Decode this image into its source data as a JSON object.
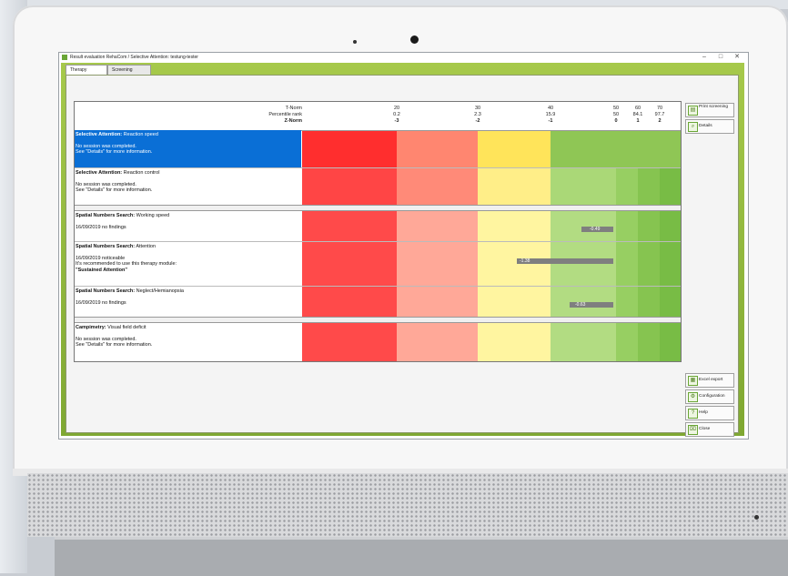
{
  "window": {
    "title": "Result evaluation RehaCom / Selective Attention: testung-tester",
    "controls": [
      "–",
      "□",
      "✕"
    ]
  },
  "tabs": [
    "Therapy",
    "Screening"
  ],
  "header": {
    "labels": [
      "T-Norm",
      "Percentile rank",
      "Z-Norm"
    ],
    "columns": [
      {
        "t": "20",
        "p": "0.2",
        "z": "-3"
      },
      {
        "t": "30",
        "p": "2.3",
        "z": "-2"
      },
      {
        "t": "40",
        "p": "15.9",
        "z": "-1"
      },
      {
        "t": "50",
        "p": "50",
        "z": "0"
      },
      {
        "t": "60",
        "p": "84.1",
        "z": "1"
      },
      {
        "t": "70",
        "p": "97.7",
        "z": "2"
      }
    ]
  },
  "rows": [
    {
      "title": "Selective Attention:",
      "subtitle": "Reaction speed",
      "line1": "No session was completed.",
      "line2": "See \"Details\" for more information.",
      "line3": "",
      "selected": true
    },
    {
      "title": "Selective Attention:",
      "subtitle": "Reaction control",
      "line1": "No session was completed.",
      "line2": "See \"Details\" for more information.",
      "line3": "",
      "selected": false
    },
    {
      "title": "Spatial Numbers Search:",
      "subtitle": "Working speed",
      "line1": "16/09/2019 no findings",
      "line2": "",
      "line3": "",
      "selected": false,
      "bar_value": "-0.49"
    },
    {
      "title": "Spatial Numbers Search:",
      "subtitle": "Attention",
      "line1": "16/09/2019 noticeable",
      "line2": "It's recommended to use this therapy module:",
      "line3": "\"Sustained Attention\"",
      "selected": false,
      "bar_value": "-1.38"
    },
    {
      "title": "Spatial Numbers Search:",
      "subtitle": "Neglect/Hemianopsia",
      "line1": "16/09/2019 no findings",
      "line2": "",
      "line3": "",
      "selected": false,
      "bar_value": "-0.63"
    },
    {
      "title": "Campimetry:",
      "subtitle": "Visual field deficit",
      "line1": "No session was completed.",
      "line2": "See \"Details\" for more information.",
      "line3": "",
      "selected": false
    }
  ],
  "side_buttons": {
    "print": "Print screening",
    "details": "Details",
    "excel": "Excel export",
    "config": "Configuration",
    "help": "Help",
    "close": "Close"
  },
  "colors": {
    "selected_row": "#0a6fd6",
    "frame_green": "#8db33a"
  }
}
